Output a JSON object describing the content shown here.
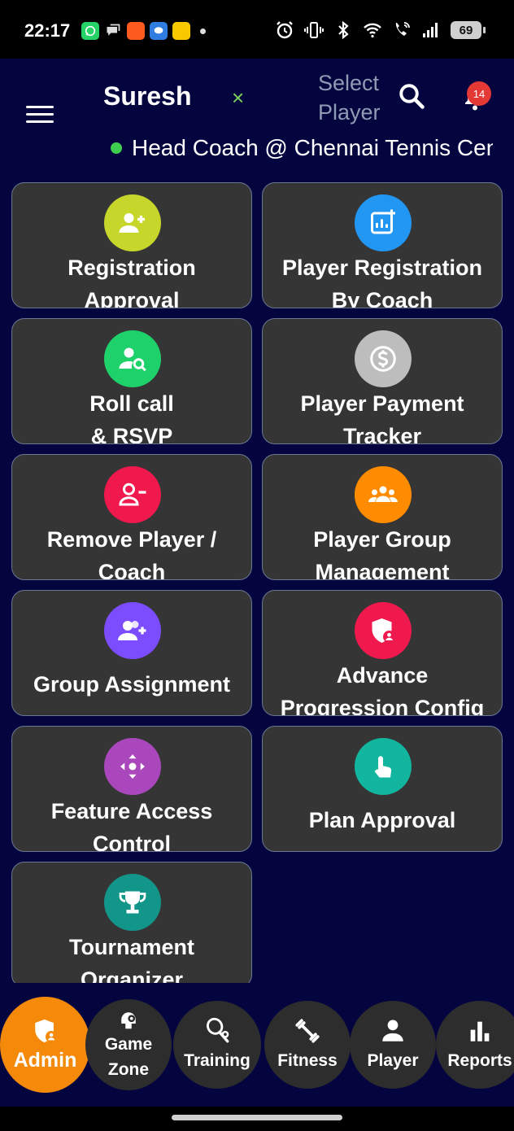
{
  "status_bar": {
    "time": "22:17",
    "battery": "69",
    "app_icons": [
      "whatsapp-icon",
      "chat-icon",
      "swiggy-icon",
      "messages-icon",
      "rapido-icon"
    ],
    "system_icons": [
      "alarm-icon",
      "vibrate-icon",
      "bluetooth-icon",
      "wifi-icon",
      "wifi-calling-icon",
      "signal-icon"
    ]
  },
  "header": {
    "user_name": "Suresh",
    "clear_symbol": "×",
    "select_player": "Select Player",
    "notification_count": "14",
    "role": "Head Coach @ Chennai Tennis Center"
  },
  "tiles": [
    {
      "id": "registration-approval",
      "label": "Registration\nApproval",
      "color": "#c6d62b",
      "icon": "person-add-icon"
    },
    {
      "id": "player-registration-by-coach",
      "label": "Player Registration\nBy Coach",
      "color": "#2196f3",
      "icon": "chart-add-icon"
    },
    {
      "id": "roll-call-rsvp",
      "label": "Roll call\n& RSVP",
      "color": "#1fd16a",
      "icon": "person-search-icon"
    },
    {
      "id": "player-payment-tracker",
      "label": "Player Payment\nTracker",
      "color": "#bdbdbd",
      "icon": "dollar-icon"
    },
    {
      "id": "remove-player-coach",
      "label": "Remove Player /\nCoach",
      "color": "#f0194e",
      "icon": "person-remove-icon"
    },
    {
      "id": "player-group-management",
      "label": "Player Group\nManagement",
      "color": "#ff8c00",
      "icon": "group-icon"
    },
    {
      "id": "group-assignment",
      "label": "Group Assignment",
      "color": "#7c4dff",
      "icon": "group-add-icon"
    },
    {
      "id": "advance-progression-config",
      "label": "Advance\nProgression Config",
      "color": "#f0194e",
      "icon": "admin-shield-icon"
    },
    {
      "id": "feature-access-control",
      "label": "Feature Access\nControl",
      "color": "#ab47bc",
      "icon": "move-arrows-icon"
    },
    {
      "id": "plan-approval",
      "label": "Plan Approval",
      "color": "#12b59e",
      "icon": "touch-icon"
    },
    {
      "id": "tournament-organizer",
      "label": "Tournament\nOrganizer",
      "color": "#13968a",
      "icon": "trophy-icon"
    }
  ],
  "bottom_nav": [
    {
      "id": "admin",
      "label": "Admin",
      "icon": "admin-shield-icon",
      "active": true
    },
    {
      "id": "game-zone",
      "label": "Game\nZone",
      "icon": "game-zone-icon",
      "active": false
    },
    {
      "id": "training",
      "label": "Training",
      "icon": "tennis-racket-icon",
      "active": false
    },
    {
      "id": "fitness",
      "label": "Fitness",
      "icon": "dumbbell-icon",
      "active": false
    },
    {
      "id": "player",
      "label": "Player",
      "icon": "person-icon",
      "active": false
    },
    {
      "id": "reports",
      "label": "Reports",
      "icon": "bar-chart-icon",
      "active": false
    }
  ],
  "colors": {
    "background": "#04053f",
    "tile_background": "#353535",
    "accent_active": "#f58a0a",
    "online": "#3fcf4f"
  }
}
